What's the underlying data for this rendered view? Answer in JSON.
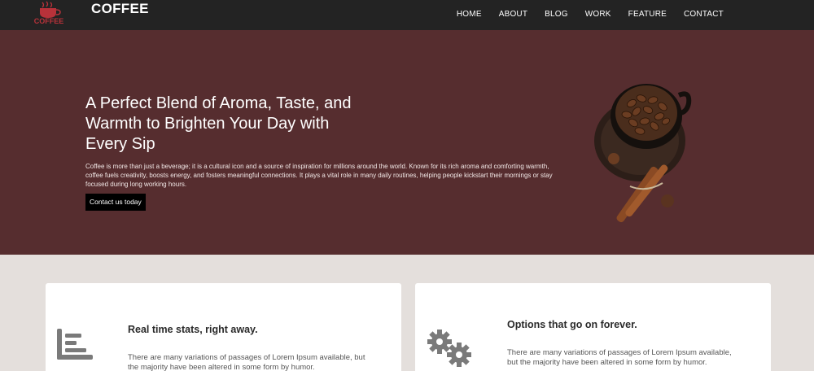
{
  "nav": {
    "brand": "COFFEE",
    "logo_text": "COFFEE",
    "items": [
      {
        "label": "HOME"
      },
      {
        "label": "ABOUT"
      },
      {
        "label": "BLOG"
      },
      {
        "label": "WORK"
      },
      {
        "label": "FEATURE"
      },
      {
        "label": "CONTACT"
      }
    ]
  },
  "hero": {
    "title": "A Perfect Blend of Aroma, Taste, and Warmth to Brighten Your Day with Every Sip",
    "text": "Coffee is more than just a beverage; it is a cultural icon and a source of inspiration for millions around the world. Known for its rich aroma and comforting warmth, coffee fuels creativity, boosts energy, and fosters meaningful connections. It plays a vital role in many daily routines, helping people kickstart their mornings or stay focused during long working hours.",
    "button": "Contact us today"
  },
  "features": [
    {
      "icon": "bar-chart-icon",
      "title": "Real time stats, right away.",
      "text": "There are many variations of passages of Lorem Ipsum available, but the majority have been altered in some form by humor."
    },
    {
      "icon": "gears-icon",
      "title": "Options that go on forever.",
      "text": "There are many variations of passages of Lorem Ipsum available, but the majority have been altered in some form by humor."
    }
  ],
  "colors": {
    "navbar": "#232323",
    "hero": "#562d2f",
    "background": "#e4dfdc",
    "button": "#000000",
    "logo_red": "#b8323a"
  }
}
